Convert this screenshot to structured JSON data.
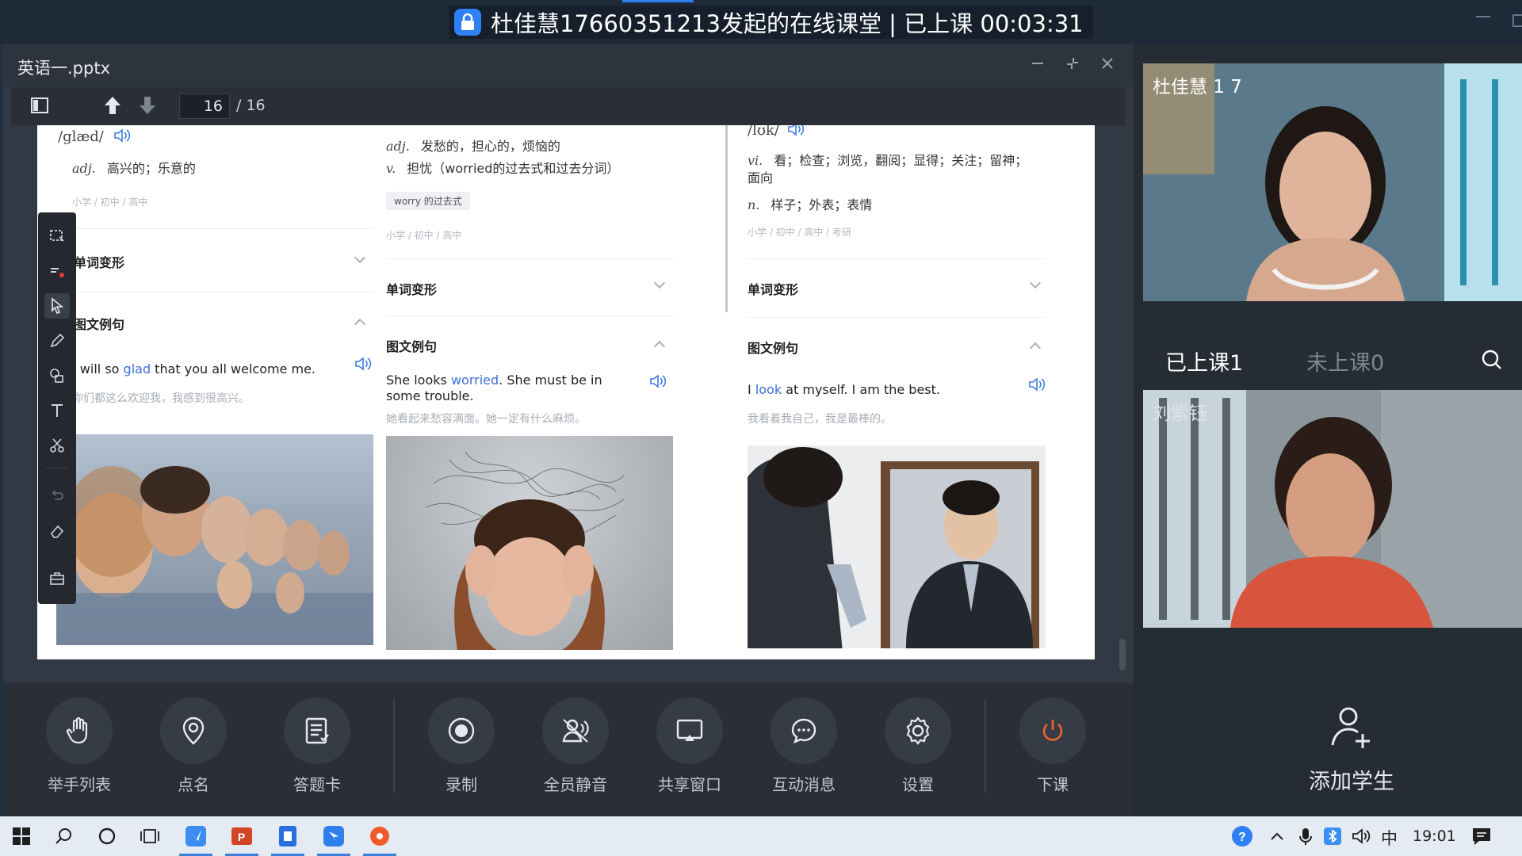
{
  "titlebar": {
    "title": "杜佳慧17660351213发起的在线课堂 | 已上课 00:03:31"
  },
  "document": {
    "file_name": "英语一.pptx",
    "current_page": "16",
    "total_pages": "/ 16"
  },
  "slide": {
    "col1": {
      "phonetic": "/glæd/",
      "definition_pos": "adj.",
      "definition_text": "高兴的；乐意的",
      "levels": "小学 / 初中 / 高中",
      "sec_forms": "单词变形",
      "sec_examples": "图文例句",
      "example_pre": "I will so ",
      "example_kw": "glad",
      "example_post": " that you all welcome me.",
      "translation": "你们都这么欢迎我，我感到很高兴。"
    },
    "col2": {
      "def1_pos": "adj.",
      "def1_text": "发愁的，担心的，烦恼的",
      "def2_pos": "v.",
      "def2_text": "担忧（worried的过去式和过去分词）",
      "tag": "worry 的过去式",
      "levels": "小学 / 初中 / 高中",
      "sec_forms": "单词变形",
      "sec_examples": "图文例句",
      "example_pre": "She looks ",
      "example_kw": "worried",
      "example_post": ". She must be in some trouble.",
      "translation": "她看起来愁容满面。她一定有什么麻烦。"
    },
    "col3": {
      "phonetic": "/lʊk/",
      "def1_pos": "vi.",
      "def1_text": "看；检查；浏览，翻阅；显得；关注；留神；面向",
      "def2_pos": "n.",
      "def2_text": "样子；外表；表情",
      "levels": "小学 / 初中 / 高中 / 考研",
      "sec_forms": "单词变形",
      "sec_examples": "图文例句",
      "example_pre": "I ",
      "example_kw": "look",
      "example_post": " at myself. I am the best.",
      "translation": "我看着我自己，我是最棒的。"
    }
  },
  "bottom_toolbar": {
    "raise_hand": "举手列表",
    "roll_call": "点名",
    "answer_card": "答题卡",
    "record": "录制",
    "mute_all": "全员静音",
    "share_window": "共享窗口",
    "messages": "互动消息",
    "settings": "设置",
    "end_class": "下课"
  },
  "right_panel": {
    "video1_name": "杜佳慧 1 7",
    "video2_name": "刘紫钰",
    "tab_attended": "已上课1",
    "tab_absent": "未上课0",
    "add_student": "添加学生"
  },
  "taskbar": {
    "ime": "中",
    "time": "19:01"
  },
  "colors": {
    "accent": "#2f7ff5",
    "end_class": "#f0642e",
    "keyword": "#3d6fd6"
  }
}
